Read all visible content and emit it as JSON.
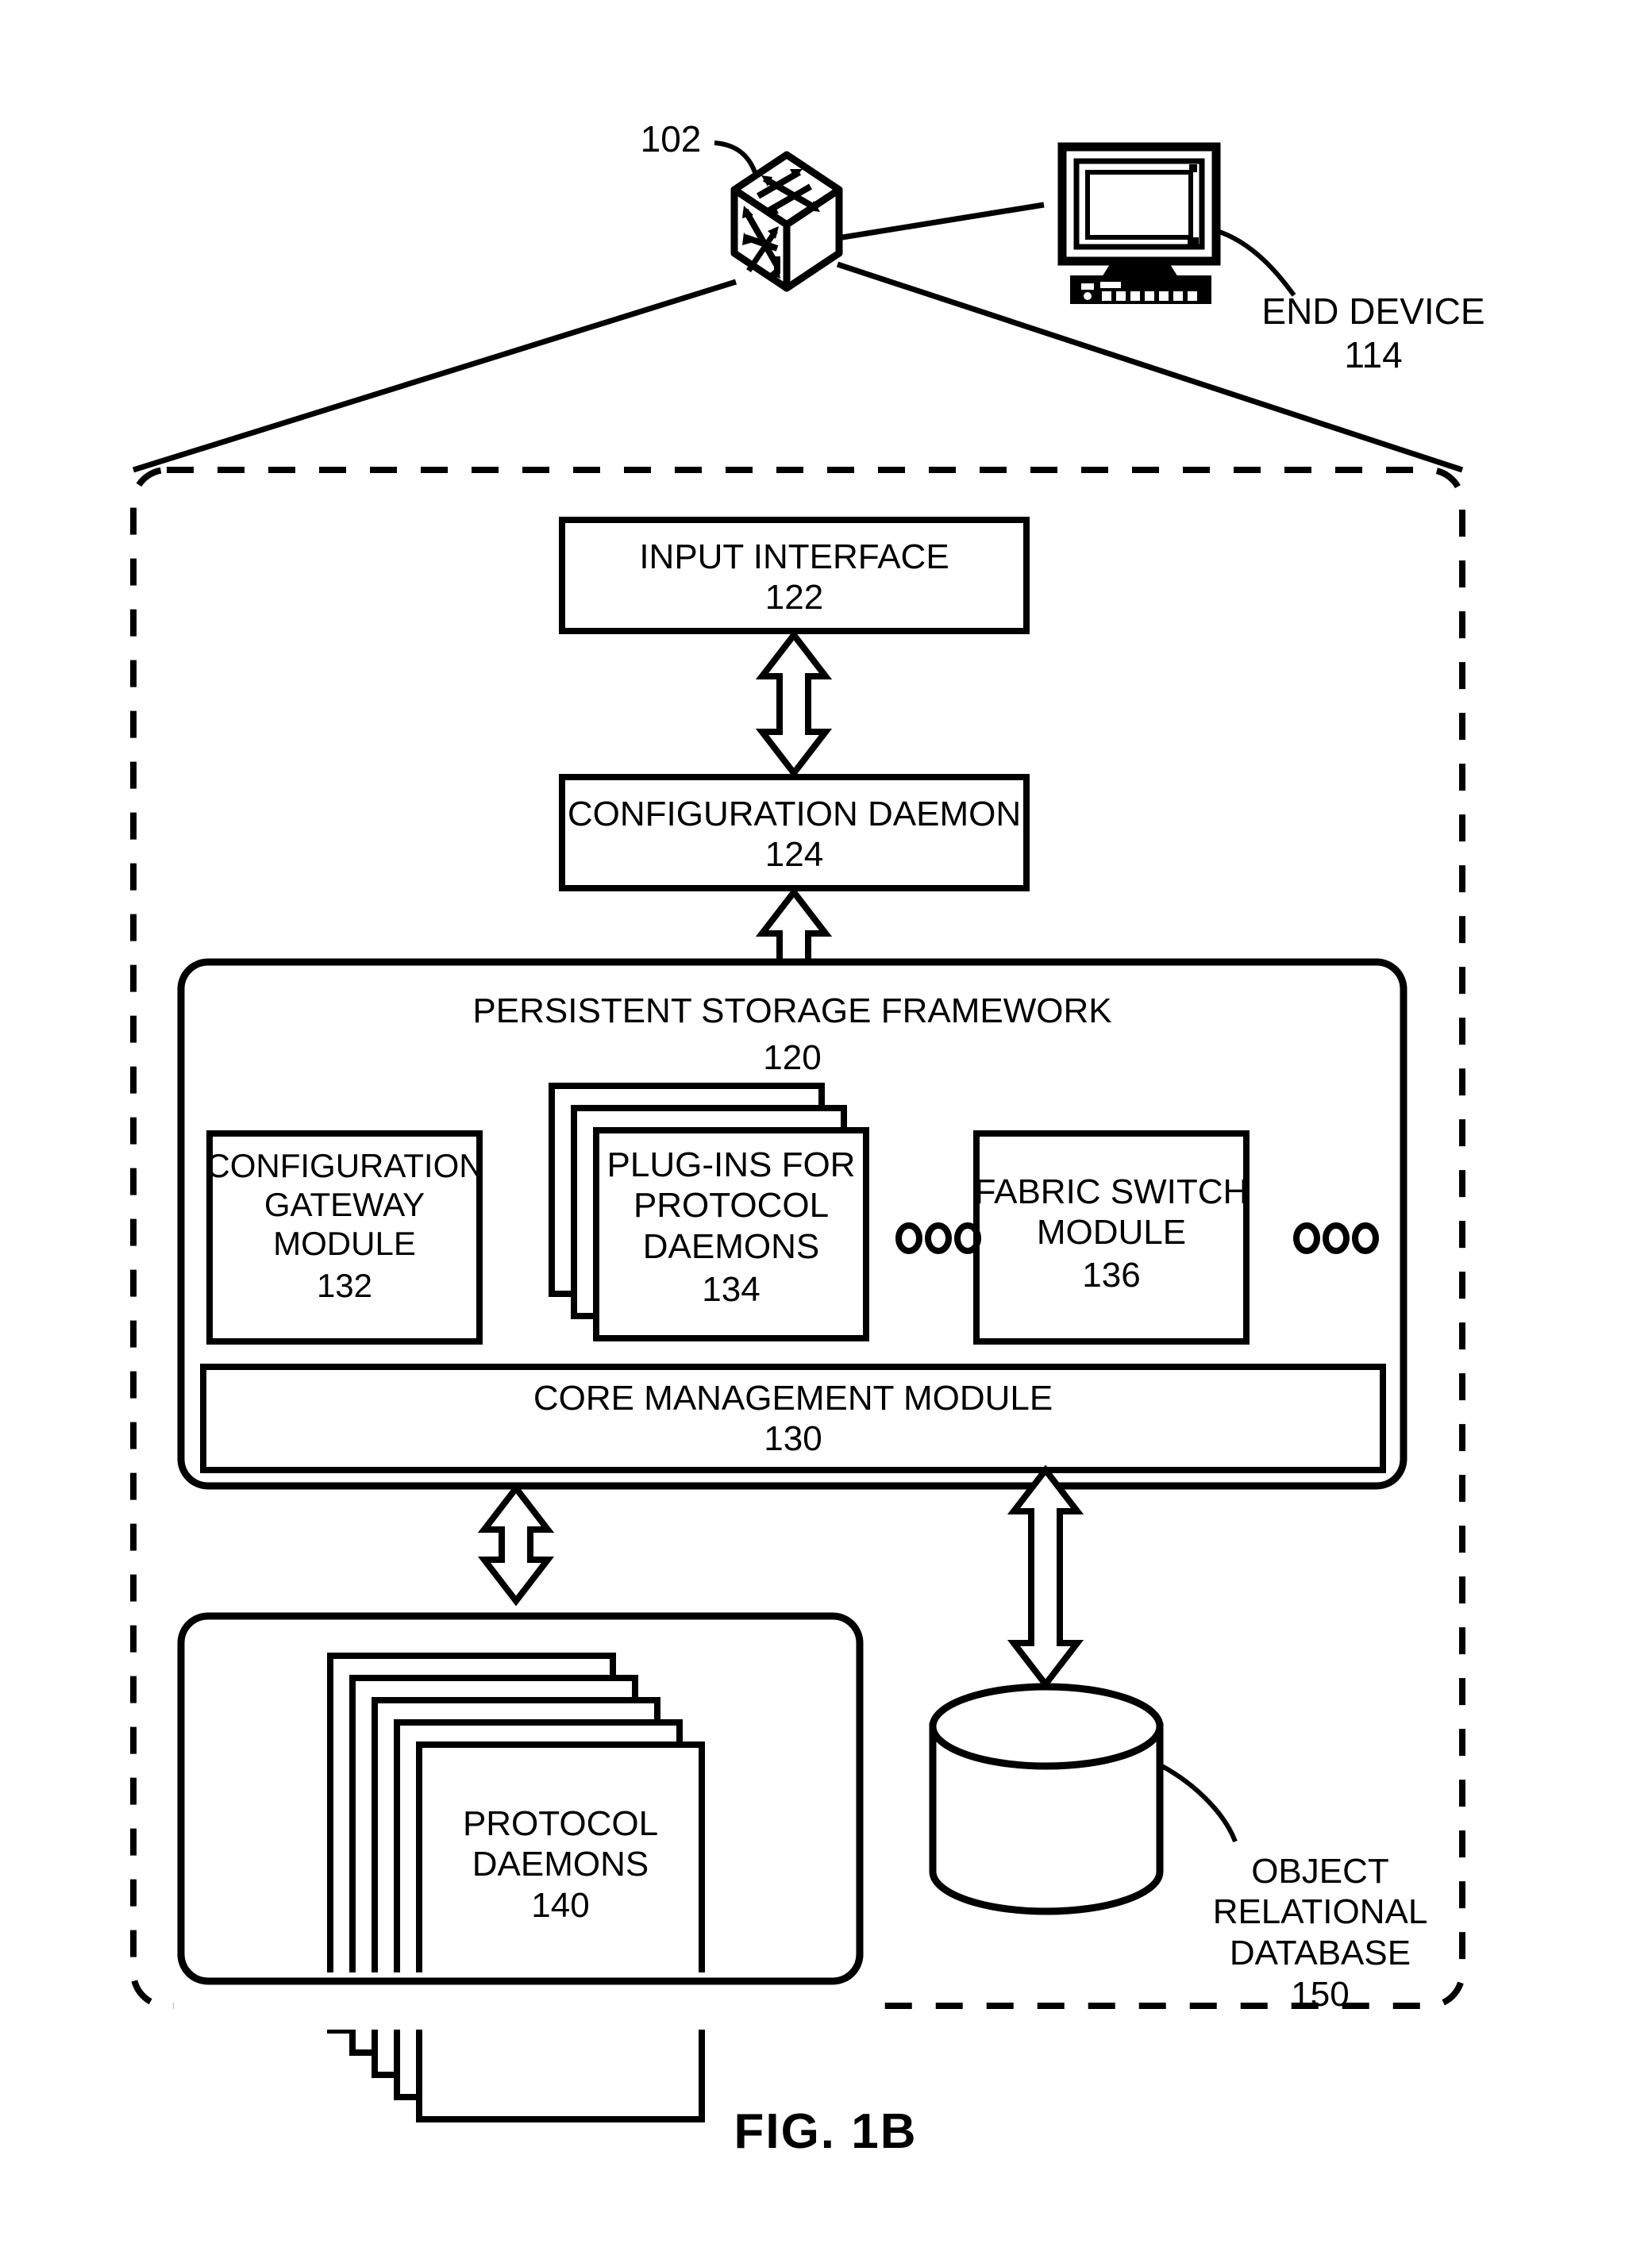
{
  "figure": {
    "caption": "FIG. 1B",
    "switch_ref": "102",
    "end_device": {
      "label": "END DEVICE",
      "ref": "114"
    },
    "boundary_style": "dashed-rounded-rectangle"
  },
  "blocks": {
    "input_interface": {
      "label": "INPUT INTERFACE",
      "ref": "122"
    },
    "configuration_daemon": {
      "label": "CONFIGURATION DAEMON",
      "ref": "124"
    },
    "persistent_storage_framework": {
      "label": "PERSISTENT STORAGE FRAMEWORK",
      "ref": "120"
    },
    "configuration_gateway_module": {
      "label": "CONFIGURATION\nGATEWAY\nMODULE",
      "ref": "132"
    },
    "plugins_for_protocol_daemons": {
      "label": "PLUG-INS FOR\nPROTOCOL\nDAEMONS",
      "ref": "134",
      "stack_count": 3
    },
    "fabric_switch_module": {
      "label": "FABRIC SWITCH\nMODULE",
      "ref": "136"
    },
    "core_management_module": {
      "label": "CORE MANAGEMENT MODULE",
      "ref": "130"
    },
    "protocol_daemons": {
      "label": "PROTOCOL\nDAEMONS",
      "ref": "140",
      "stack_count": 5
    },
    "object_relational_database": {
      "label": "OBJECT\nRELATIONAL\nDATABASE",
      "ref": "150"
    }
  },
  "ellipses": {
    "left_group": "ooo",
    "right_group": "ooo",
    "dot_count": 3
  },
  "connectors": [
    {
      "name": "input-interface-to-configuration-daemon",
      "type": "double-arrow-vertical"
    },
    {
      "name": "configuration-daemon-to-persistent-storage-framework",
      "type": "double-arrow-vertical"
    },
    {
      "name": "core-management-module-to-protocol-daemons",
      "type": "double-arrow-vertical"
    },
    {
      "name": "core-management-module-to-object-relational-database",
      "type": "double-arrow-vertical"
    },
    {
      "name": "switch-to-end-device",
      "type": "line"
    },
    {
      "name": "switch-to-boundary-left",
      "type": "line"
    },
    {
      "name": "switch-to-boundary-right",
      "type": "line"
    }
  ],
  "colors": {
    "stroke": "#000000",
    "fill": "#ffffff",
    "background": "#ffffff"
  }
}
